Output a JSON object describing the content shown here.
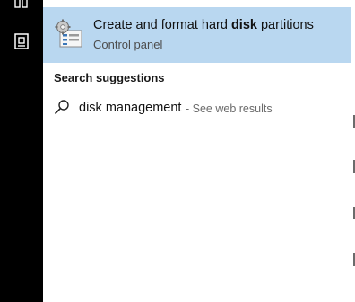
{
  "left_rail": {
    "icons": [
      "documents-icon",
      "store-icon"
    ]
  },
  "best_match": {
    "title_before": "Create and format hard ",
    "title_bold": "disk",
    "title_after": " partitions",
    "subtitle": "Control panel",
    "icon": "disk-management-icon"
  },
  "search_suggestions": {
    "label": "Search suggestions",
    "items": [
      {
        "query": "disk management",
        "hint": "- See web results",
        "icon": "search-icon"
      }
    ]
  },
  "colors": {
    "rail": "#000000",
    "highlight": "#b9d7f0",
    "hint_text": "#6b6b6b"
  }
}
